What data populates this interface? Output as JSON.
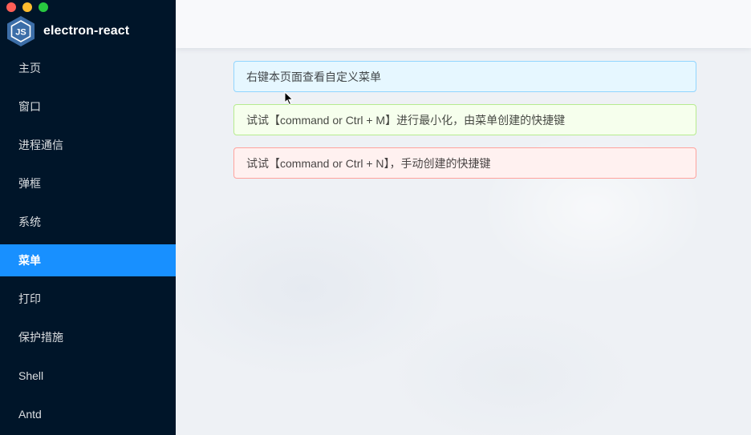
{
  "app": {
    "title": "electron-react",
    "accent_color": "#1890ff",
    "sidebar_color": "#001529"
  },
  "window_controls": [
    "close",
    "minimize",
    "maximize"
  ],
  "logo": {
    "icon": "nodejs-hexagon-icon",
    "text": "JS"
  },
  "sidebar": {
    "items": [
      {
        "label": "主页",
        "active": false
      },
      {
        "label": "窗口",
        "active": false
      },
      {
        "label": "进程通信",
        "active": false
      },
      {
        "label": "弹框",
        "active": false
      },
      {
        "label": "系统",
        "active": false
      },
      {
        "label": "菜单",
        "active": true
      },
      {
        "label": "打印",
        "active": false
      },
      {
        "label": "保护措施",
        "active": false
      },
      {
        "label": "Shell",
        "active": false
      },
      {
        "label": "Antd",
        "active": false
      }
    ]
  },
  "alerts": [
    {
      "type": "info",
      "text": "右键本页面查看自定义菜单"
    },
    {
      "type": "success",
      "text": "试试【command or Ctrl + M】进行最小化，由菜单创建的快捷键"
    },
    {
      "type": "error",
      "text": "试试【command or Ctrl + N】，手动创建的快捷键"
    }
  ]
}
